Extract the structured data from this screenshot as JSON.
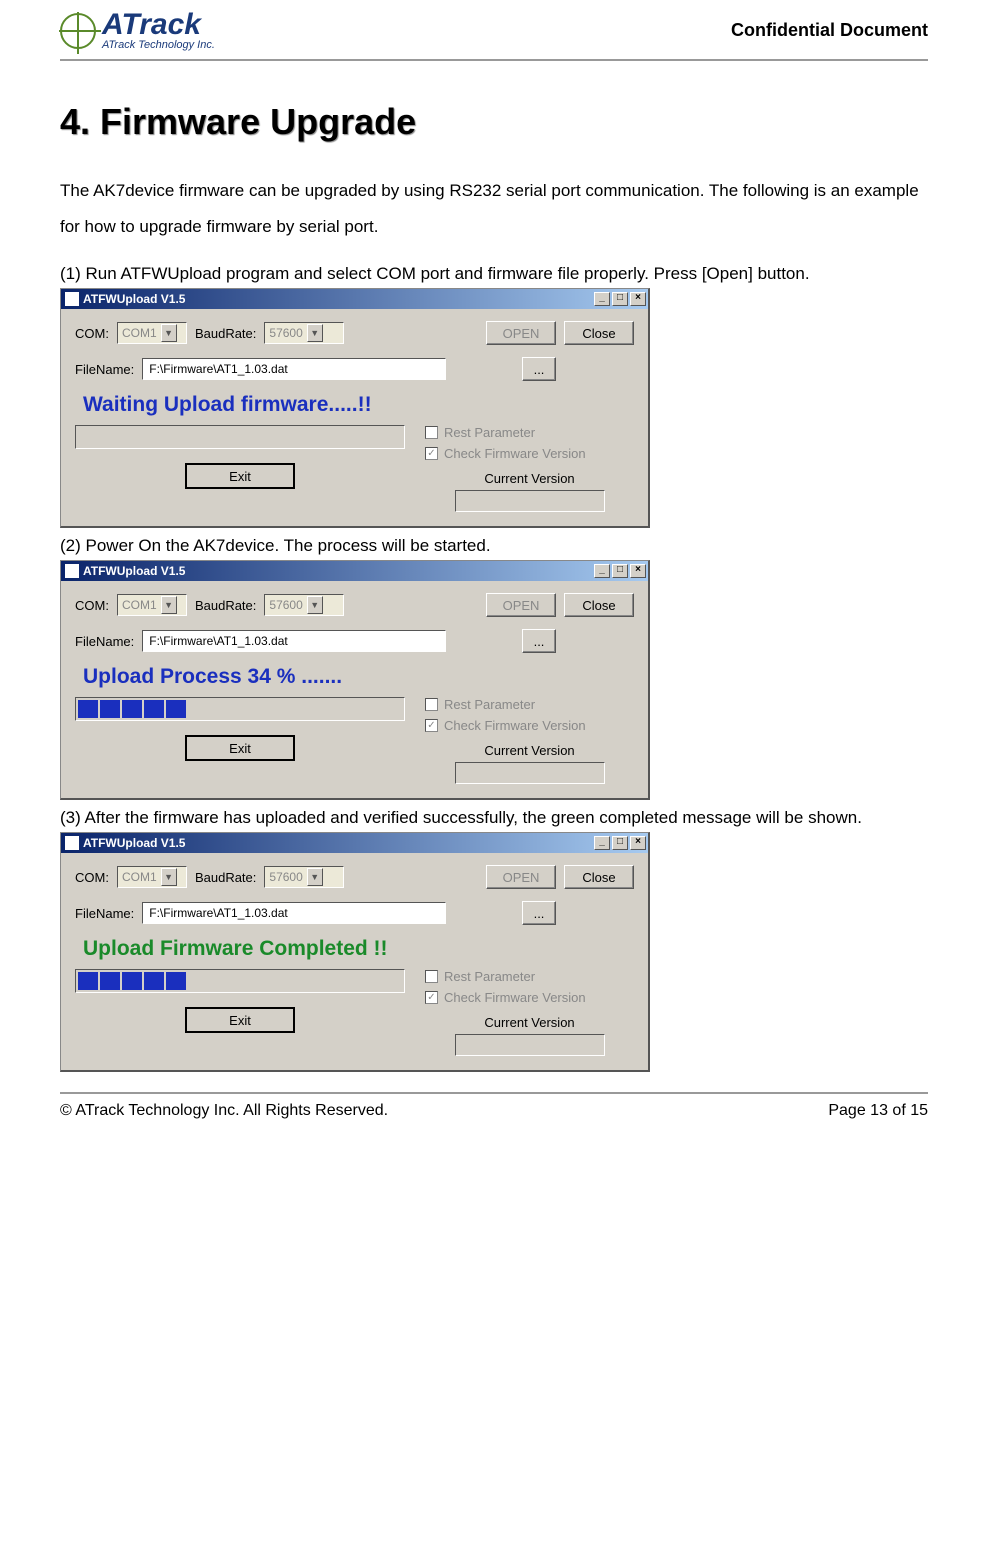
{
  "header": {
    "company": "ATrack",
    "company_sub": "ATrack Technology Inc.",
    "confidential": "Confidential Document"
  },
  "section": {
    "title": "4. Firmware Upgrade",
    "intro": "The AK7device firmware can be upgraded by using RS232 serial port communication. The following is an example for how to upgrade firmware by serial port.",
    "step1": "(1)  Run ATFWUpload program and select COM port and firmware file properly. Press [Open] button.",
    "step2": "(2)  Power On the AK7device. The process will be started.",
    "step3": "(3)  After the firmware has uploaded and verified successfully, the green completed message will be shown."
  },
  "dlg": {
    "title": "ATFWUpload V1.5",
    "com_label": "COM:",
    "com_value": "COM1",
    "baud_label": "BaudRate:",
    "baud_value": "57600",
    "open": "OPEN",
    "close": "Close",
    "file_label": "FileName:",
    "file_value": "F:\\Firmware\\AT1_1.03.dat",
    "browse": "...",
    "rest_param": "Rest Parameter",
    "check_fw": "Check Firmware Version",
    "current_version": "Current Version",
    "exit": "Exit",
    "status1": "Waiting Upload firmware.....!!",
    "status2": "Upload Process 34 % .......",
    "status3": "Upload Firmware Completed !!",
    "progress_segments": 5
  },
  "footer": {
    "copyright": "© ATrack Technology Inc. All Rights Reserved.",
    "page": "Page 13 of 15"
  }
}
